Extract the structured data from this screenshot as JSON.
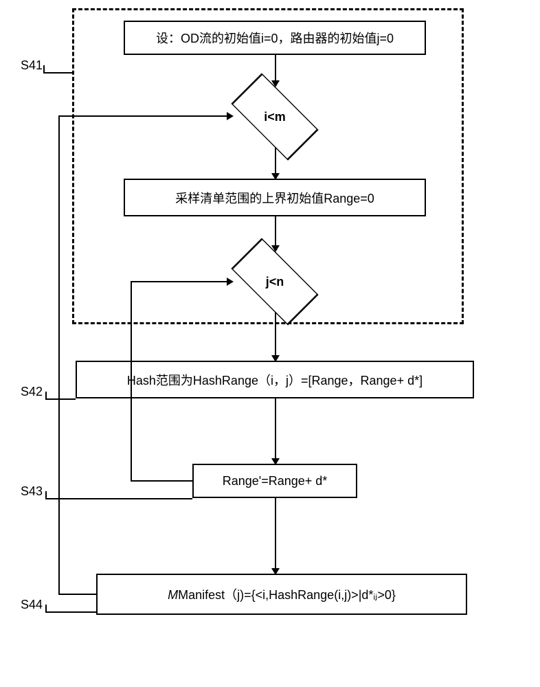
{
  "labels": {
    "s41": "S41",
    "s42": "S42",
    "s43": "S43",
    "s44": "S44"
  },
  "nodes": {
    "init": "设：OD流的初始值i=0，路由器的初始值j=0",
    "cond_i": "i<m",
    "range_init": "采样清单范围的上界初始值Range=0",
    "cond_j": "j<n",
    "hash_range": "Hash范围为HashRange（i，j）=[Range，Range+ d*]",
    "range_update": "Range'=Range+ d*",
    "manifest": "Manifest（j)={<i,HashRange(i,j)>|d*ᵢⱼ>0}"
  }
}
